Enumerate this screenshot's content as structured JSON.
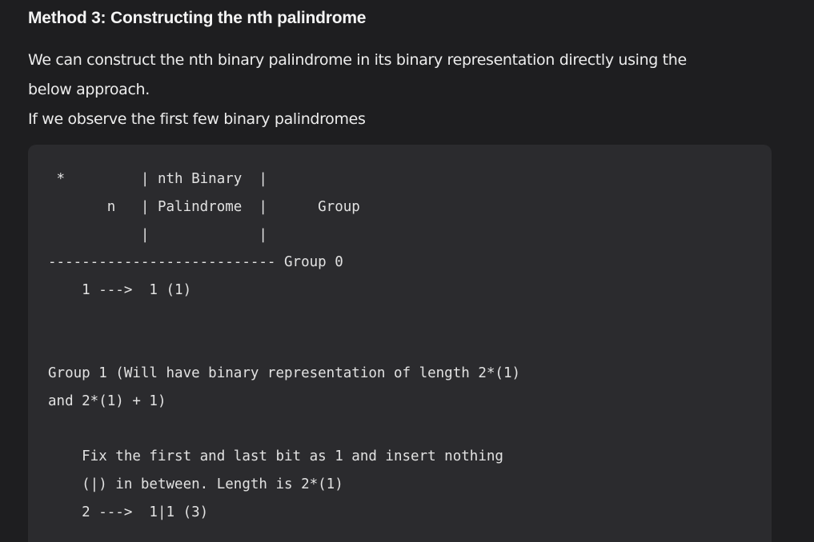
{
  "article": {
    "heading": "Method 3: Constructing the nth palindrome",
    "paragraphs": [
      "We can construct the nth binary palindrome in its binary representation directly using the",
      "below approach.",
      "If we observe the first few binary palindromes"
    ]
  },
  "code_block": {
    "lines": [
      " *         | nth Binary  |",
      "       n   | Palindrome  |      Group",
      "           |             |",
      "--------------------------- Group 0",
      "    1 --->  1 (1)",
      "",
      "",
      "Group 1 (Will have binary representation of length 2*(1)",
      "and 2*(1) + 1)",
      "",
      "    Fix the first and last bit as 1 and insert nothing",
      "    (|) in between. Length is 2*(1)",
      "    2 --->  1|1 (3)"
    ]
  }
}
